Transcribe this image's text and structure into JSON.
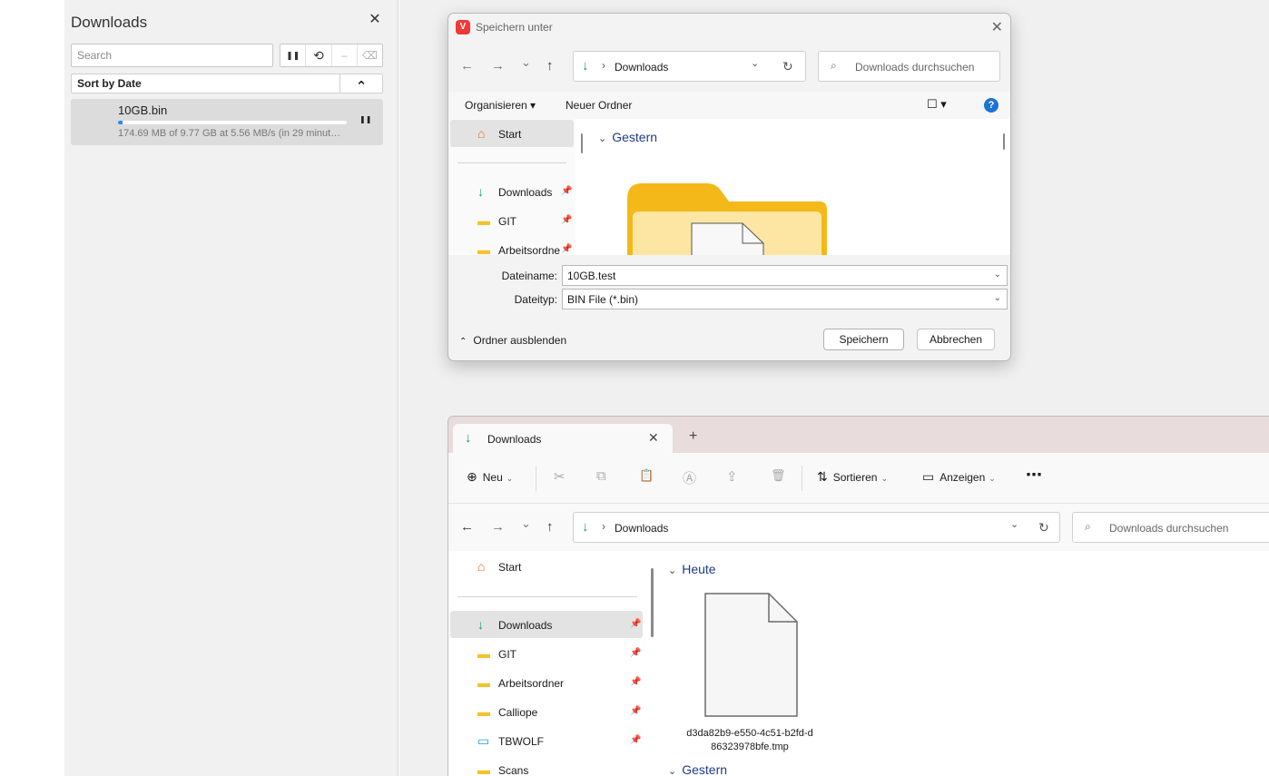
{
  "downloads_panel": {
    "title": "Downloads",
    "close_glyph": "✕",
    "search_placeholder": "Search",
    "tools": [
      {
        "icon": "pause-icon",
        "glyph": "❚❚"
      },
      {
        "icon": "history-icon",
        "glyph": "⟲"
      },
      {
        "icon": "minus-icon",
        "glyph": "–"
      },
      {
        "icon": "broom-icon",
        "glyph": "⌫"
      }
    ],
    "sort_label": "Sort by Date",
    "sort_toggle_glyph": "⌃",
    "items": [
      {
        "name": "10GB.bin",
        "status": "174.69 MB of 9.77 GB at 5.56 MB/s (in 29 minut…",
        "progress": 0.018,
        "pause_glyph": "❚❚"
      }
    ]
  },
  "save_dialog": {
    "app_icon": "vivaldi-icon",
    "app_icon_glyph": "V",
    "title": "Speichern unter",
    "close_glyph": "✕",
    "nav": {
      "back": "←",
      "forward": "→",
      "recent": "⌄",
      "up": "↑"
    },
    "address": {
      "icon": "download-icon",
      "icon_glyph": "↓",
      "sep": "›",
      "path": "Downloads",
      "dropdown": "⌄",
      "refresh": "↻"
    },
    "search_placeholder": "Downloads durchsuchen",
    "search_glyph": "⌕",
    "toolbar": {
      "organize": "Organisieren ▾",
      "new_folder": "Neuer Ordner",
      "view": "☐ ▾",
      "help": "?"
    },
    "sidebar": [
      {
        "label": "Start",
        "icon": "home-icon",
        "glyph": "⌂",
        "selected": true,
        "pinned": false
      },
      {
        "label": "Downloads",
        "icon": "download-icon",
        "glyph": "↓",
        "selected": false,
        "pinned": true
      },
      {
        "label": "GIT",
        "icon": "folder-icon",
        "glyph": "▬",
        "selected": false,
        "pinned": true
      },
      {
        "label": "Arbeitsordne",
        "icon": "folder-icon",
        "glyph": "▬",
        "selected": false,
        "pinned": true
      }
    ],
    "pin_glyph": "📌",
    "group_chevron": "⌄",
    "group": "Gestern",
    "file_name_label": "Dateiname:",
    "file_name_value": "10GB.test",
    "file_type_label": "Dateityp:",
    "file_type_value": "BIN File (*.bin)",
    "dropdown_glyph": "⌄",
    "hide_folders_glyph": "⌃",
    "hide_folders": "Ordner ausblenden",
    "save_button": "Speichern",
    "cancel_button": "Abbrechen"
  },
  "explorer": {
    "tab_icon_glyph": "↓",
    "tab_title": "Downloads",
    "tab_close_glyph": "✕",
    "new_tab_glyph": "+",
    "commands": {
      "new": "Neu",
      "new_glyph": "⊕",
      "caret": "⌄",
      "icons": [
        {
          "icon": "cut-icon",
          "glyph": "✂"
        },
        {
          "icon": "copy-icon",
          "glyph": "⧉"
        },
        {
          "icon": "paste-icon",
          "glyph": "📋"
        },
        {
          "icon": "rename-icon",
          "glyph": "Ⓐ"
        },
        {
          "icon": "share-icon",
          "glyph": "⇪"
        },
        {
          "icon": "delete-icon",
          "glyph": "🗑"
        }
      ],
      "sort": "Sortieren",
      "sort_glyph": "⇅",
      "view": "Anzeigen",
      "view_glyph": "▭",
      "more": "⋯"
    },
    "nav": {
      "back": "←",
      "forward": "→",
      "recent": "⌄",
      "up": "↑"
    },
    "address": {
      "icon_glyph": "↓",
      "sep": "›",
      "path": "Downloads",
      "dropdown": "⌄",
      "refresh": "↻"
    },
    "search_placeholder": "Downloads durchsuchen",
    "search_glyph": "⌕",
    "sidebar": [
      {
        "label": "Start",
        "icon": "home-icon",
        "glyph": "⌂",
        "selected": false,
        "pinned": false
      },
      {
        "label": "Downloads",
        "icon": "download-icon",
        "glyph": "↓",
        "selected": true,
        "pinned": true
      },
      {
        "label": "GIT",
        "icon": "folder-icon",
        "glyph": "▬",
        "selected": false,
        "pinned": true
      },
      {
        "label": "Arbeitsordner",
        "icon": "folder-icon",
        "glyph": "▬",
        "selected": false,
        "pinned": true
      },
      {
        "label": "Calliope",
        "icon": "folder-icon",
        "glyph": "▬",
        "selected": false,
        "pinned": true
      },
      {
        "label": "TBWOLF",
        "icon": "monitor-icon",
        "glyph": "▭",
        "selected": false,
        "pinned": true
      },
      {
        "label": "Scans",
        "icon": "folder-icon",
        "glyph": "▬",
        "selected": false,
        "pinned": false
      }
    ],
    "pin_glyph": "📌",
    "group_chevron": "⌄",
    "group_today": "Heute",
    "file": {
      "line1": "d3da82b9-e550-4c51-b2fd-d",
      "line2": "86323978bfe.tmp"
    },
    "group_yesterday": "Gestern"
  },
  "colors": {
    "accent_blue": "#2b8ae8",
    "download_green": "#1a9c6f",
    "vivaldi_red": "#ef3939",
    "folder_yellow": "#f4c22b",
    "group_heading": "#1f3b86"
  }
}
